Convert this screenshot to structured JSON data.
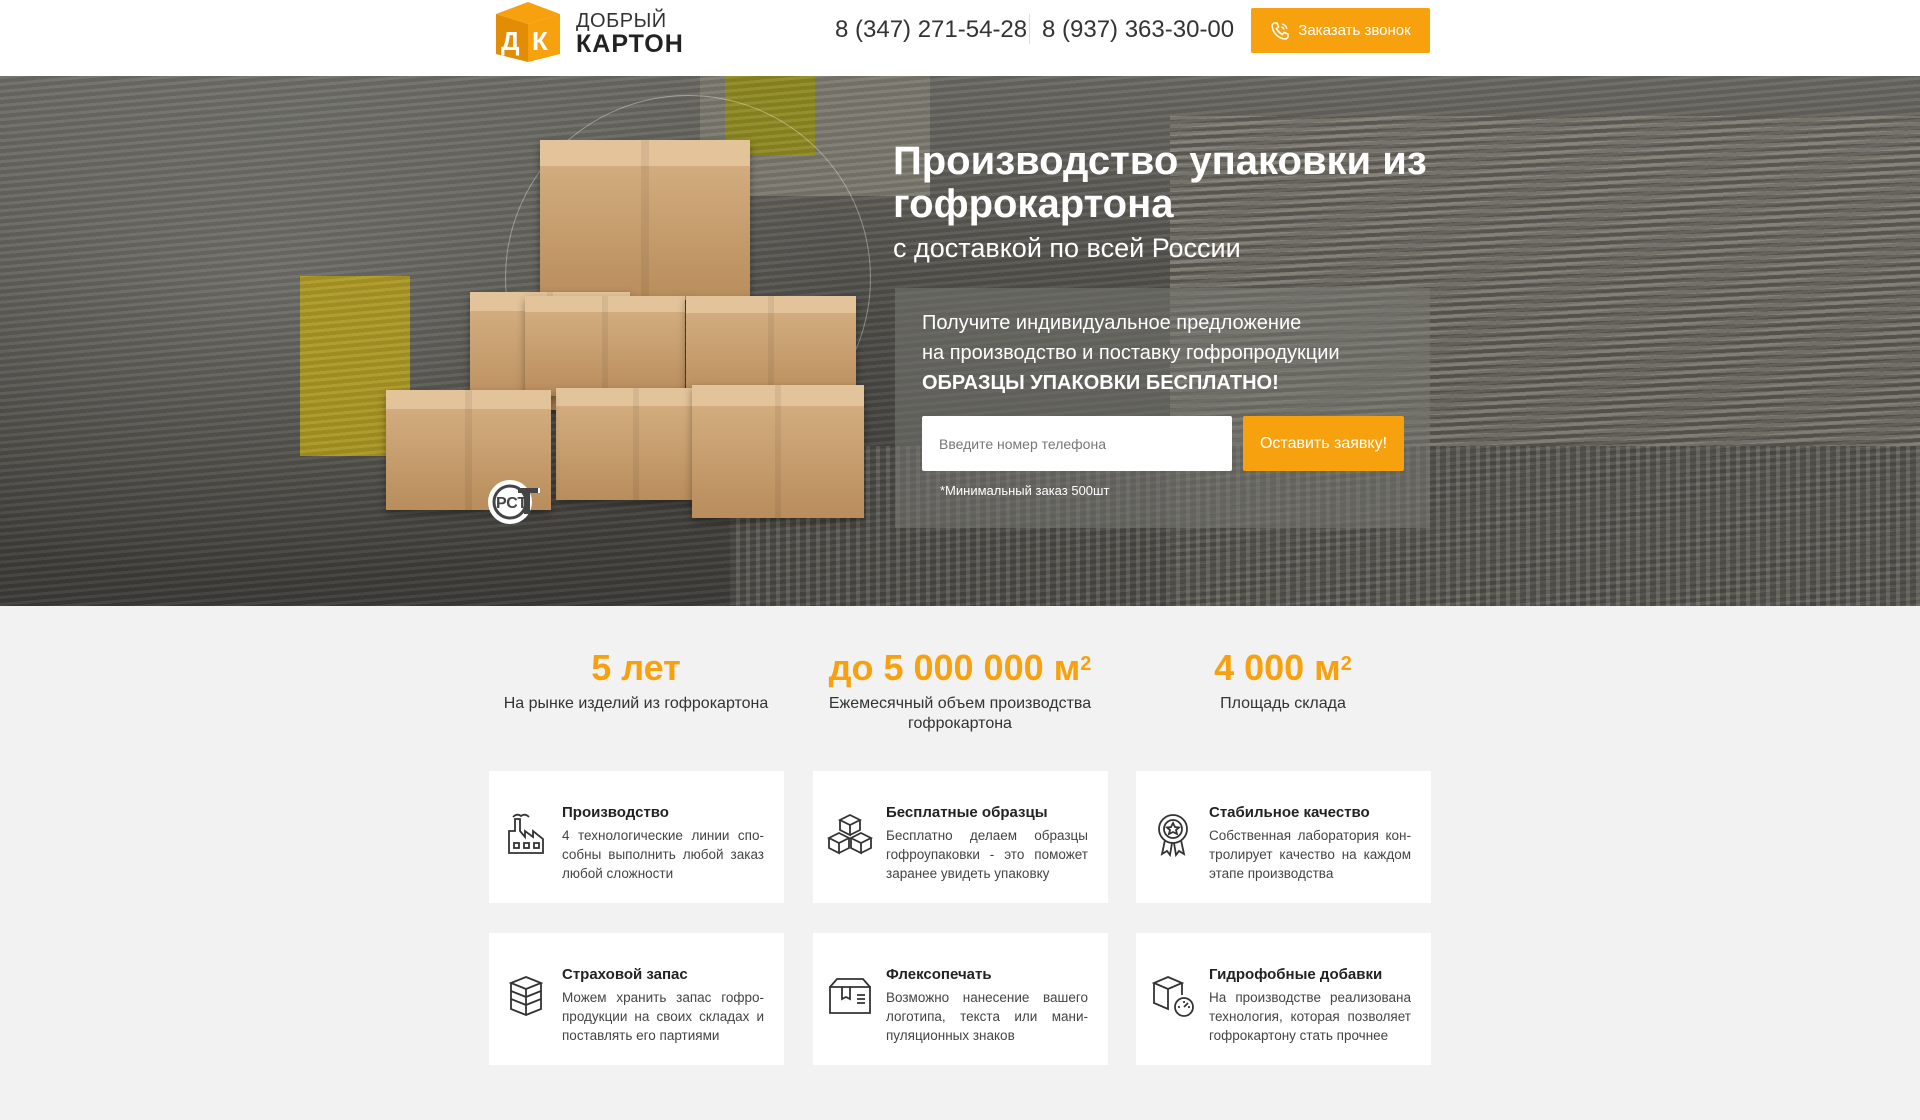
{
  "header": {
    "logo_line1": "ДОБРЫЙ",
    "logo_line2": "КАРТОН",
    "logo_mark": "ДК",
    "phone1": "8 (347) 271-54-28",
    "phone2": "8 (937) 363-30-00",
    "callback_label": "Заказать звонок",
    "callback_icon": "phone-icon"
  },
  "hero": {
    "title": "Производство упаковки из гофрокартона",
    "subtitle": "с доставкой по всей России",
    "form": {
      "line1": "Получите индивидуальное предложение",
      "line2": "на производство и поставку гофропродукции",
      "line3": "ОБРАЗЦЫ УПАКОВКИ БЕСПЛАТНО!",
      "phone_placeholder": "Введите номер телефона",
      "submit_label": "Оставить заявку!",
      "min_order": "*Минимальный заказ 500шт"
    },
    "certification_mark": "РСТ"
  },
  "stats": [
    {
      "value": "5 лет",
      "sup": "",
      "label": "На рынке изделий из гофрокартона"
    },
    {
      "value": "до 5 000 000 м",
      "sup": "2",
      "label": "Ежемесячный объем производства гофрокартона"
    },
    {
      "value": "4 000 м",
      "sup": "2",
      "label": "Площадь склада"
    }
  ],
  "features": [
    {
      "title": "Производство",
      "text": "4 технологические линии спо-собны выполнить любой заказ любой сложности",
      "icon": "factory-icon"
    },
    {
      "title": "Бесплатные образцы",
      "text": "Бесплатно делаем образцы гофроупаковки - это поможет заранее увидеть упаковку",
      "icon": "boxes-icon"
    },
    {
      "title": "Стабильное качество",
      "text": "Собственная лаборатория кон-тролирует качество на каждом этапе производства",
      "icon": "quality-badge-icon"
    },
    {
      "title": "Страховой запас",
      "text": "Можем хранить запас гофро-продукции на своих складах и поставлять его партиями",
      "icon": "box-stack-icon"
    },
    {
      "title": "Флексопечать",
      "text": "Возможно нанесение вашего логотипа, текста или мани-пуляционных знаков",
      "icon": "printed-box-icon"
    },
    {
      "title": "Гидрофобные добавки",
      "text": "На производстве реализована технология, которая позволяет гофрокартону стать прочнее",
      "icon": "box-gauge-icon"
    }
  ],
  "colors": {
    "accent": "#f7a10e",
    "text": "#222222",
    "background": "#f2f2f2"
  }
}
